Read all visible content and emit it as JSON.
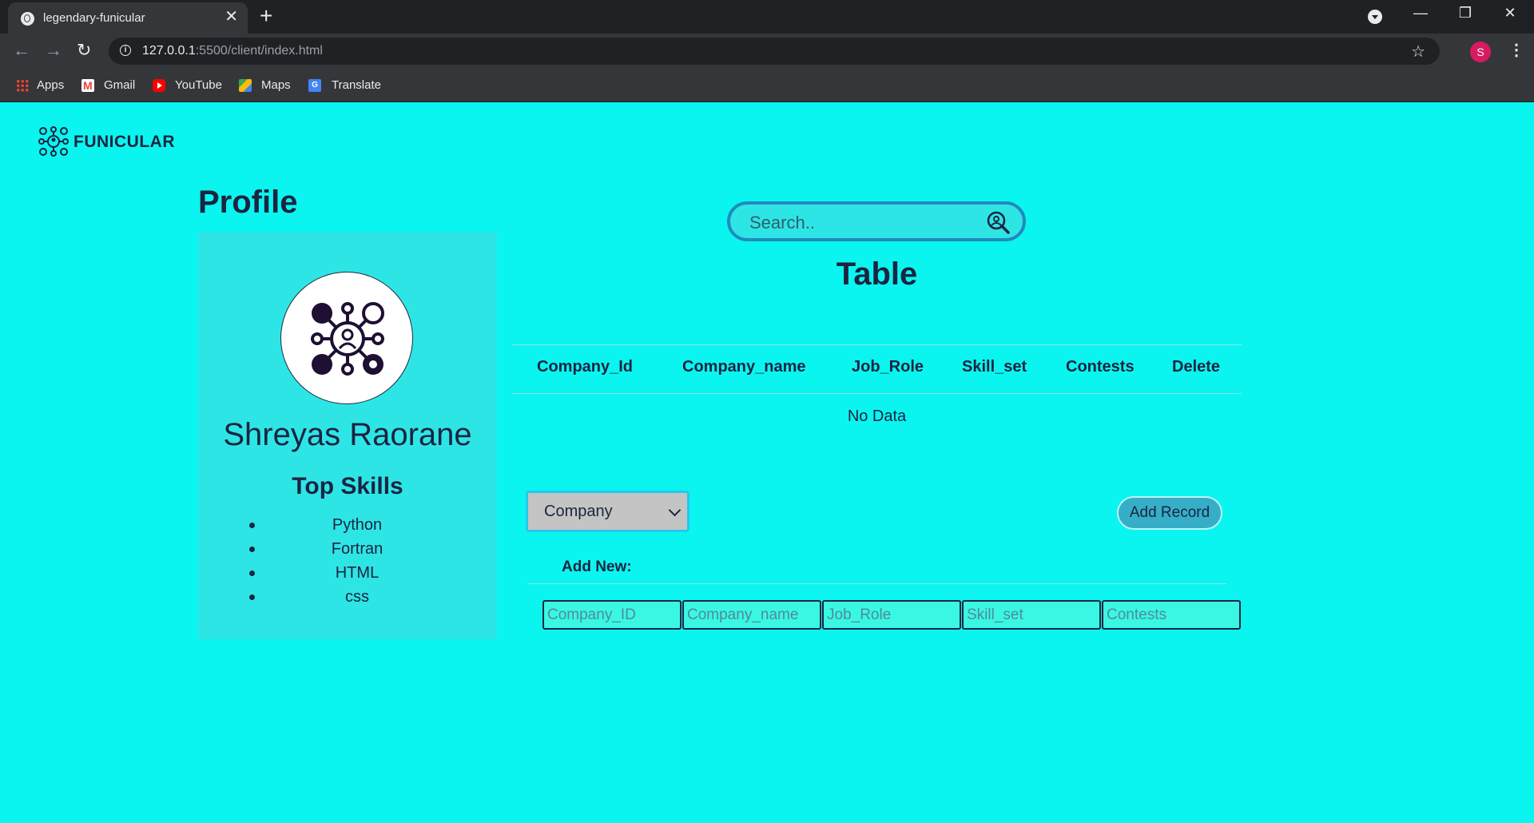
{
  "browser": {
    "tab_title": "legendary-funicular",
    "url_host": "127.0.0.1",
    "url_path": ":5500/client/index.html",
    "profile_initial": "S",
    "bookmarks": [
      {
        "label": "Apps",
        "icon": "apps-grid-icon"
      },
      {
        "label": "Gmail",
        "icon": "gmail-icon"
      },
      {
        "label": "YouTube",
        "icon": "youtube-icon"
      },
      {
        "label": "Maps",
        "icon": "maps-icon"
      },
      {
        "label": "Translate",
        "icon": "translate-icon"
      }
    ]
  },
  "brand": {
    "name": "FUNICULAR"
  },
  "profile": {
    "title": "Profile",
    "user_name": "Shreyas Raorane",
    "skills_title": "Top Skills",
    "skills": [
      "Python",
      "Fortran",
      "HTML",
      "css"
    ]
  },
  "search": {
    "placeholder": "Search.."
  },
  "table": {
    "title": "Table",
    "columns": [
      "Company_Id",
      "Company_name",
      "Job_Role",
      "Skill_set",
      "Contests",
      "Delete"
    ],
    "empty_text": "No Data"
  },
  "controls": {
    "select_value": "Company",
    "add_record_label": "Add Record",
    "add_new_label": "Add New:"
  },
  "form": {
    "placeholders": [
      "Company_ID",
      "Company_name",
      "Job_Role",
      "Skill_set",
      "Contests"
    ]
  },
  "colors": {
    "page_bg": "#0af5f0",
    "card_bg": "#2ee5e6",
    "text": "#1b2440",
    "accent": "#1f8bbd"
  }
}
